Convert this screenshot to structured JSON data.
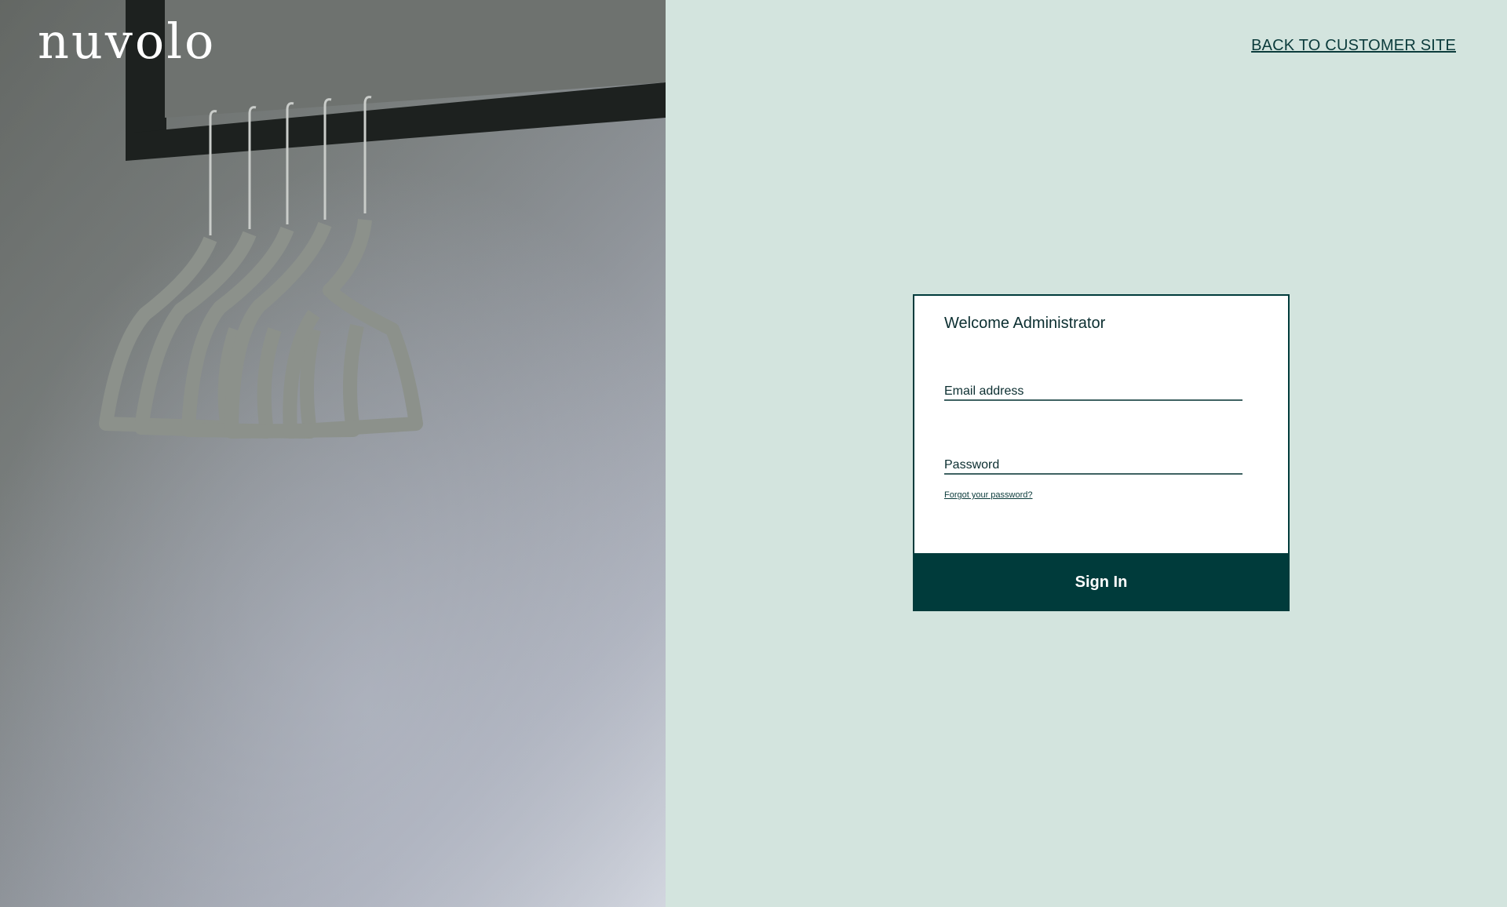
{
  "brand": {
    "logo_text": "nuvolo"
  },
  "header": {
    "back_link_label": "BACK TO CUSTOMER SITE"
  },
  "login_card": {
    "title": "Welcome Administrator",
    "email_placeholder": "Email address",
    "email_value": "",
    "password_placeholder": "Password",
    "password_value": "",
    "forgot_password_label": "Forgot your password?",
    "sign_in_label": "Sign In"
  },
  "colors": {
    "panel_background": "#d3e4de",
    "accent": "#003b3b",
    "card_background": "#ffffff",
    "text": "#0b2e30"
  },
  "photo": {
    "subject": "clothes-hangers-on-rail-photo"
  }
}
